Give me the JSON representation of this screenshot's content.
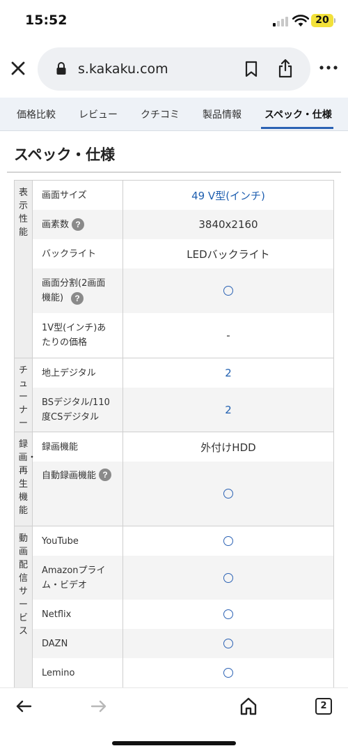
{
  "status": {
    "time": "15:52",
    "battery": "20"
  },
  "browser": {
    "url": "s.kakaku.com",
    "tab_count": "2"
  },
  "tabs": [
    {
      "label": "価格比較",
      "active": false
    },
    {
      "label": "レビュー",
      "active": false
    },
    {
      "label": "クチコミ",
      "active": false
    },
    {
      "label": "製品情報",
      "active": false
    },
    {
      "label": "スペック・仕様",
      "active": true
    }
  ],
  "section": {
    "title": "スペック・仕様"
  },
  "spec": {
    "groups": [
      {
        "category": "表示性能",
        "rows": [
          {
            "name": "画面サイズ",
            "value": "49 V型(インチ)",
            "help": false
          },
          {
            "name": "画素数",
            "value": "3840x2160",
            "help": true
          },
          {
            "name": "バックライト",
            "value": "LEDバックライト",
            "help": false
          },
          {
            "name": "画面分割(2画面機能)",
            "value": "○",
            "help": true
          },
          {
            "name": "1V型(インチ)あたりの価格",
            "value": "-",
            "help": false
          }
        ]
      },
      {
        "category": "チューナー",
        "rows": [
          {
            "name": "地上デジタル",
            "value": "2",
            "help": false
          },
          {
            "name": "BSデジタル/110度CSデジタル",
            "value": "2",
            "help": false
          }
        ]
      },
      {
        "category": "録画・再生機能",
        "rows": [
          {
            "name": "録画機能",
            "value": "外付けHDD",
            "help": false
          },
          {
            "name": "自動録画機能",
            "value": "○",
            "help": true
          }
        ]
      },
      {
        "category": "動画配信サービス",
        "rows": [
          {
            "name": "YouTube",
            "value": "○",
            "help": false
          },
          {
            "name": "Amazonプライム・ビデオ",
            "value": "○",
            "help": false
          },
          {
            "name": "Netflix",
            "value": "○",
            "help": false
          },
          {
            "name": "DAZN",
            "value": "○",
            "help": false
          },
          {
            "name": "Lemino",
            "value": "○",
            "help": false
          }
        ]
      }
    ]
  },
  "colors": {
    "accent": "#2b62b4",
    "link": "#1f5fb0",
    "battery": "#f2e13a"
  }
}
